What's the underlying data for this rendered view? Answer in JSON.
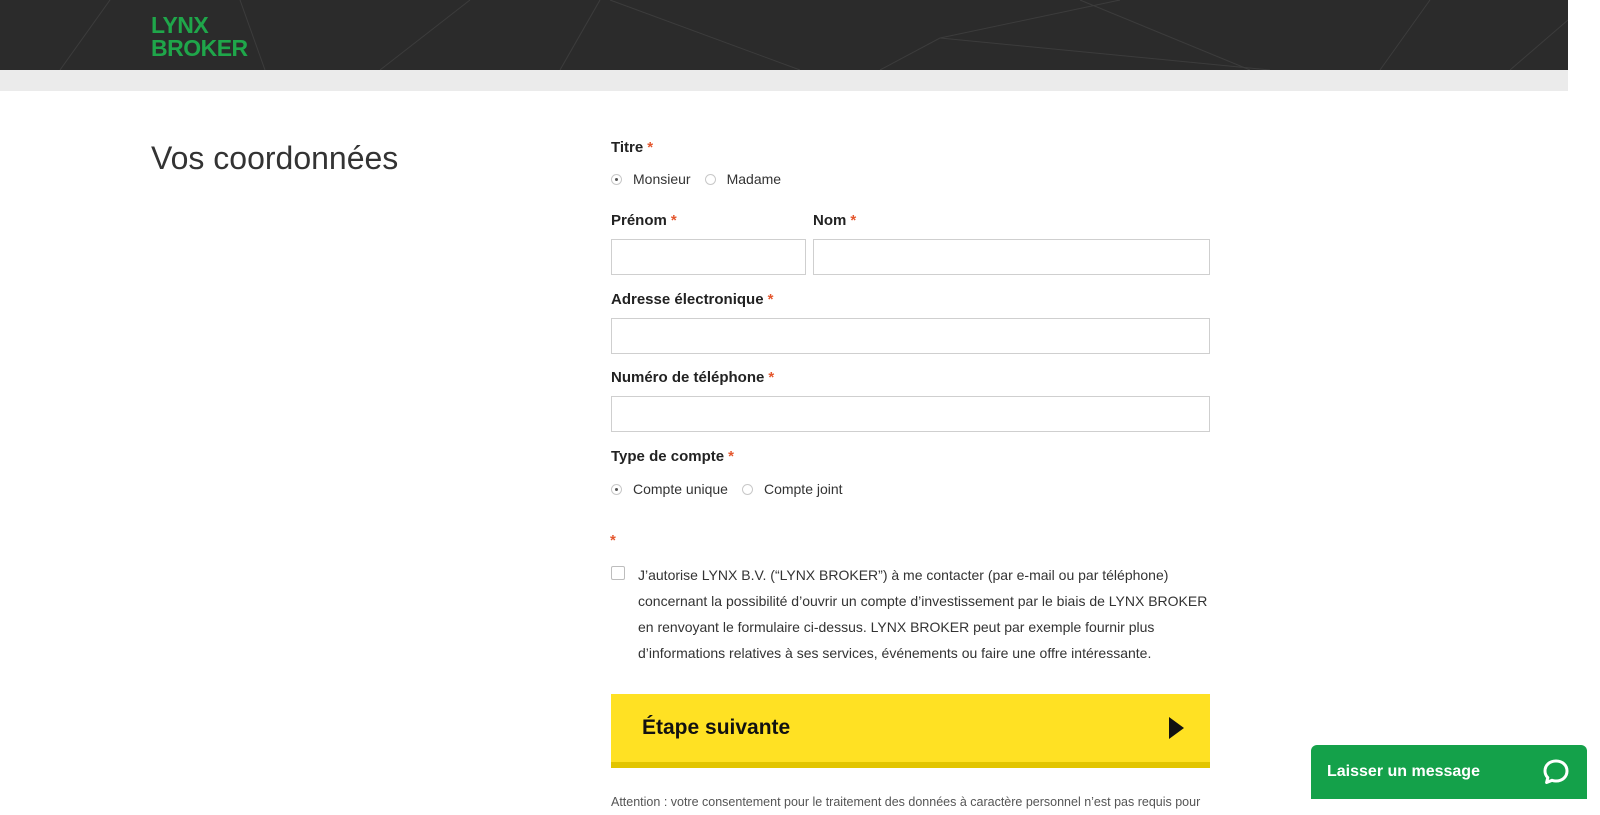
{
  "brand": {
    "logo_line1": "LYNX",
    "logo_line2": "BROKER",
    "color": "#1fa64a"
  },
  "page": {
    "section_title": "Vos coordonnées"
  },
  "required_mark": "*",
  "form": {
    "titre": {
      "label": "Titre",
      "options": [
        "Monsieur",
        "Madame"
      ],
      "selected": "Monsieur"
    },
    "prenom": {
      "label": "Prénom",
      "value": ""
    },
    "nom": {
      "label": "Nom",
      "value": ""
    },
    "email": {
      "label": "Adresse électronique",
      "value": ""
    },
    "phone": {
      "label": "Numéro de téléphone",
      "value": ""
    },
    "account_type": {
      "label": "Type de compte",
      "options": [
        "Compte unique",
        "Compte joint"
      ],
      "selected": "Compte unique"
    },
    "consent": {
      "checked": false,
      "text": "J’autorise LYNX B.V. (“LYNX BROKER”) à me contacter (par e-mail ou par téléphone) concernant la possibilité d’ouvrir un compte d’investissement par le biais de LYNX BROKER en renvoyant le formulaire ci-dessus. LYNX BROKER peut par exemple fournir plus d’informations relatives à ses services, événements ou faire une offre intéressante."
    },
    "submit_label": "Étape suivante",
    "note": "Attention : votre consentement pour le traitement des données à caractère personnel n’est pas requis pour"
  },
  "chat": {
    "label": "Laisser un message",
    "icon": "chat-bubble-icon",
    "color": "#14a14a"
  },
  "colors": {
    "cta": "#ffe123",
    "required": "#e4572e",
    "header": "#2b2b2b"
  }
}
